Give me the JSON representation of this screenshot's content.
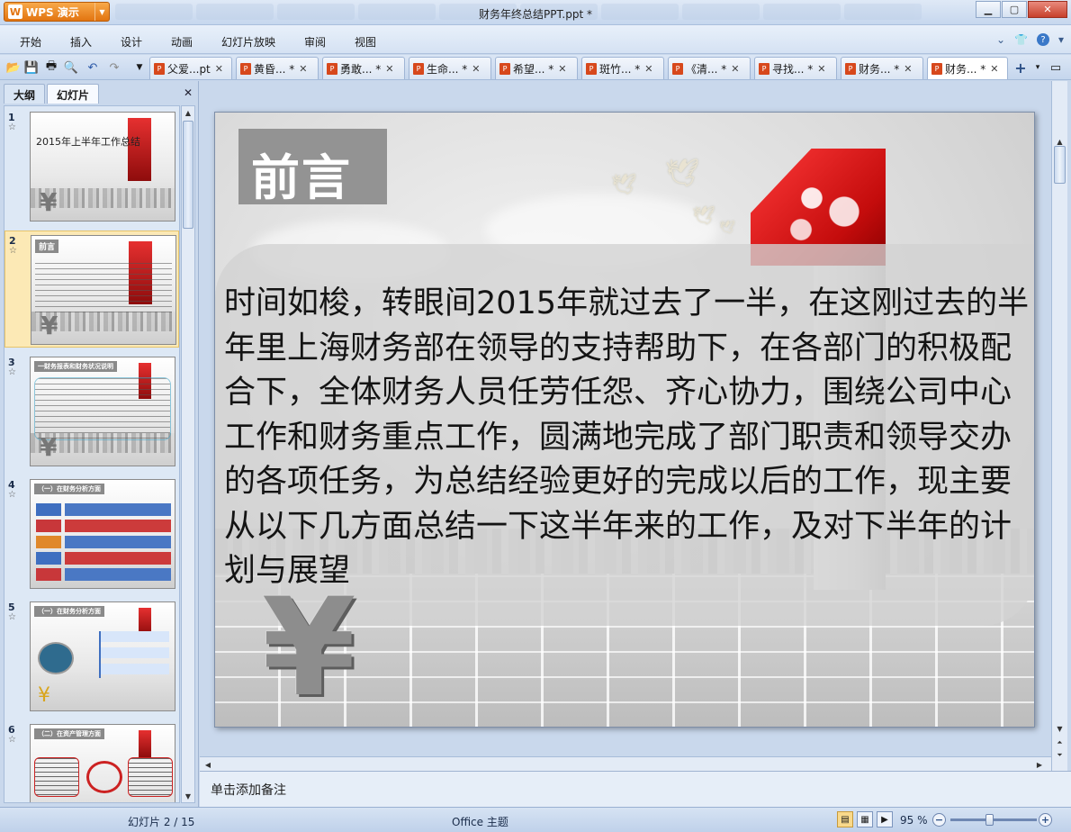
{
  "app": {
    "logo_letter": "W",
    "name": "WPS 演示",
    "window_title": "财务年终总结PPT.ppt *"
  },
  "menu": {
    "items": [
      "开始",
      "插入",
      "设计",
      "动画",
      "幻灯片放映",
      "审阅",
      "视图"
    ]
  },
  "doc_tabs": [
    "父爱...pt",
    "黄昏... *",
    "勇敢... *",
    "生命... *",
    "希望... *",
    "斑竹... *",
    "《清... *",
    "寻找... *",
    "财务... *",
    "财务... *"
  ],
  "active_tab_index": 9,
  "left_pane": {
    "tabs": [
      "大纲",
      "幻灯片"
    ],
    "active_tab": "幻灯片",
    "thumbnails": [
      {
        "num": "1",
        "caption": "2015年上半年工作总结"
      },
      {
        "num": "2",
        "caption": "前言"
      },
      {
        "num": "3",
        "caption": "一财务报表和财务状况说明"
      },
      {
        "num": "4",
        "caption": "（一）在财务分析方面"
      },
      {
        "num": "5",
        "caption": "（一）在财务分析方面"
      },
      {
        "num": "6",
        "caption": "（二）在资产管理方面"
      }
    ],
    "selected": "2"
  },
  "slide": {
    "heading": "前言",
    "body": "时间如梭，转眼间2015年就过去了一半，在这刚过去的半年里上海财务部在领导的支持帮助下，在各部门的积极配合下，全体财务人员任劳任怨、齐心协力，围绕公司中心工作和财务重点工作，圆满地完成了部门职责和领导交办的各项任务，为总结经验更好的完成以后的工作，现主要从以下几方面总结一下这半年来的工作，及对下半年的计划与展望",
    "yen_symbol": "¥"
  },
  "notes": {
    "placeholder": "单击添加备注"
  },
  "status": {
    "slide_indicator": "幻灯片 2 / 15",
    "theme": "Office 主题",
    "zoom": "95 %"
  }
}
